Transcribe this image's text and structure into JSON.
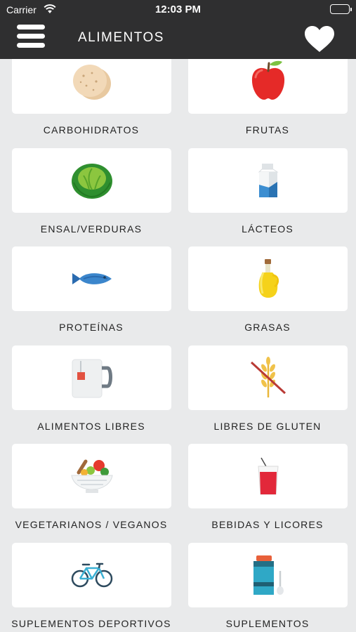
{
  "status_bar": {
    "carrier": "Carrier",
    "time": "12:03 PM"
  },
  "nav": {
    "title": "ALIMENTOS"
  },
  "categories": [
    {
      "label": "CARBOHIDRATOS",
      "icon": "tortilla-icon"
    },
    {
      "label": "FRUTAS",
      "icon": "apple-icon"
    },
    {
      "label": "ENSAL/VERDURAS",
      "icon": "lettuce-icon"
    },
    {
      "label": "LÁCTEOS",
      "icon": "milk-carton-icon"
    },
    {
      "label": "PROTEÍNAS",
      "icon": "fish-icon"
    },
    {
      "label": "GRASAS",
      "icon": "oil-bottle-icon"
    },
    {
      "label": "ALIMENTOS LIBRES",
      "icon": "tea-mug-icon"
    },
    {
      "label": "LIBRES DE GLUTEN",
      "icon": "gluten-free-icon"
    },
    {
      "label": "VEGETARIANOS / VEGANOS",
      "icon": "salad-bowl-icon"
    },
    {
      "label": "BEBIDAS Y LICORES",
      "icon": "drink-glass-icon"
    },
    {
      "label": "SUPLEMENTOS DEPORTIVOS",
      "icon": "bicycle-icon"
    },
    {
      "label": "SUPLEMENTOS",
      "icon": "supplement-bottle-icon"
    }
  ]
}
